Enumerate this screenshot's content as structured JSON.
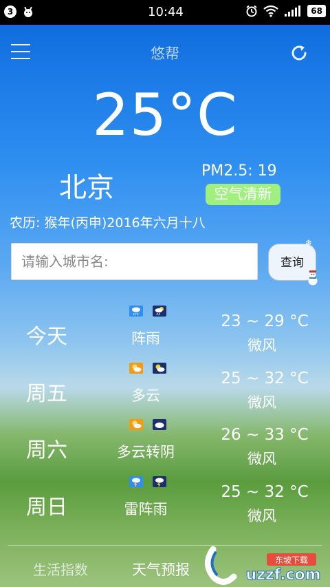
{
  "status_bar": {
    "notification_count": "3",
    "time": "10:44",
    "battery": "68"
  },
  "header": {
    "title": "悠帮"
  },
  "current": {
    "temperature": "25°C",
    "city": "北京",
    "pm25": "PM2.5:  19",
    "air_quality": "空气清新",
    "lunar_date": "农历:  猴年(丙申)2016年六月十八"
  },
  "search": {
    "placeholder": "请输入城市名:",
    "button_label": "查询"
  },
  "forecast": [
    {
      "day": "今天",
      "desc": "阵雨",
      "temp": "23 ~ 29 °C",
      "wind": "微风",
      "icon_day": "shower-day-icon",
      "icon_night": "shower-night-icon"
    },
    {
      "day": "周五",
      "desc": "多云",
      "temp": "25 ~ 32 °C",
      "wind": "微风",
      "icon_day": "cloudy-day-icon",
      "icon_night": "cloudy-night-icon"
    },
    {
      "day": "周六",
      "desc": "多云转阴",
      "temp": "26 ~ 33 °C",
      "wind": "微风",
      "icon_day": "cloudy-day-icon",
      "icon_night": "overcast-night-icon"
    },
    {
      "day": "周日",
      "desc": "雷阵雨",
      "temp": "25 ~ 32 °C",
      "wind": "微风",
      "icon_day": "thunderstorm-day-icon",
      "icon_night": "thunderstorm-night-icon"
    }
  ],
  "tabs": {
    "life_index": "生活指数",
    "forecast": "天气预报",
    "third": "..."
  },
  "watermark": {
    "text": "东坡下载",
    "logo": "uzzf.com"
  },
  "colors": {
    "air_quality_badge": "#9ff07e",
    "sky_top": "#0a66d9",
    "grass": "#5a9c3e"
  }
}
